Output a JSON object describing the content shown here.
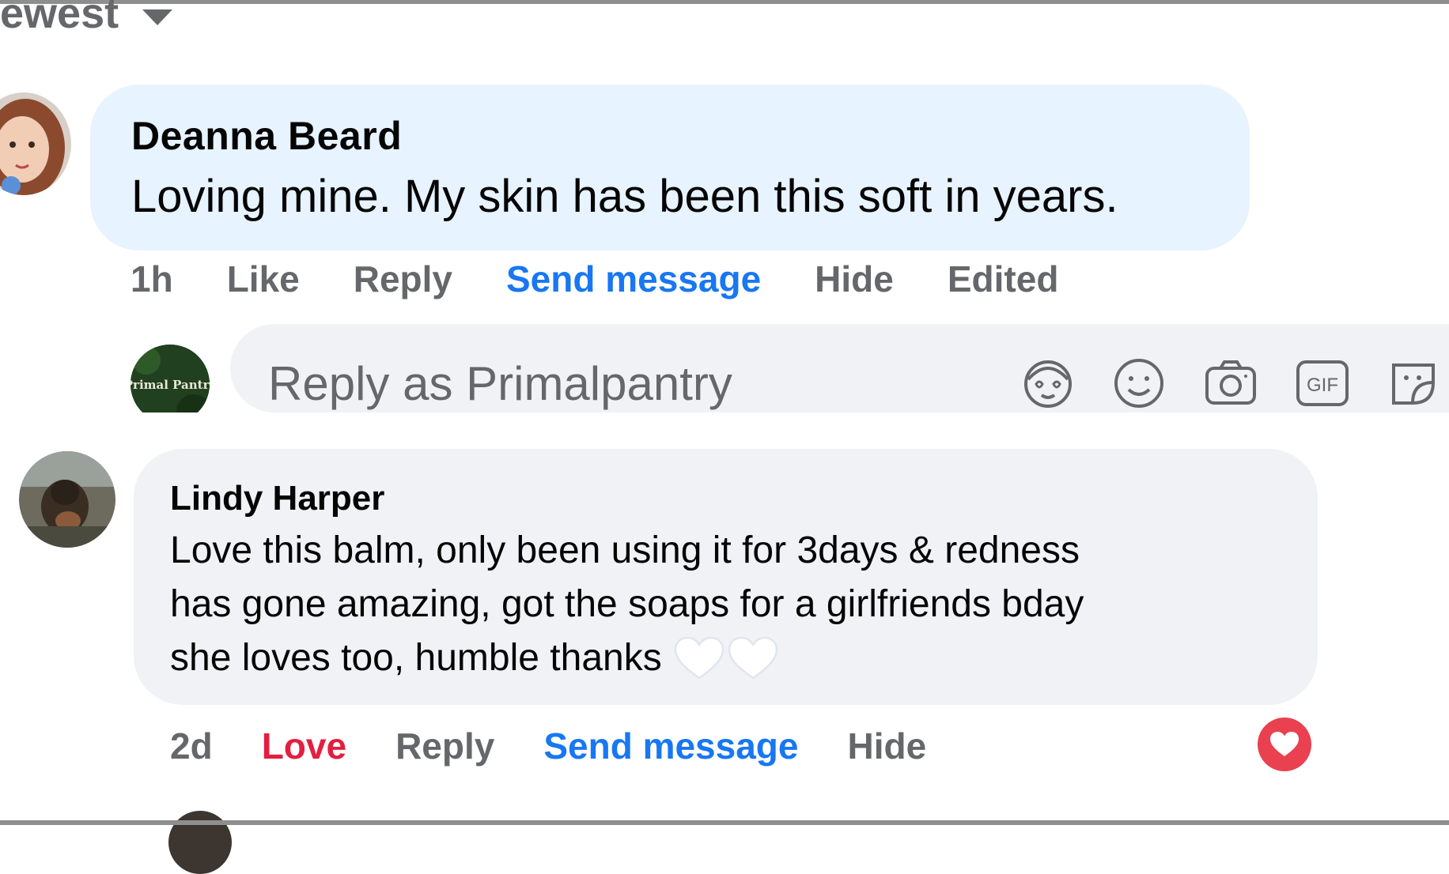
{
  "sort": {
    "label": "ewest",
    "icon": "caret-down-icon"
  },
  "comments": [
    {
      "author": "Deanna Beard",
      "text": "Loving mine. My skin has been this soft in years.",
      "time": "1h",
      "actions": {
        "like": "Like",
        "reply": "Reply",
        "send_message": "Send message",
        "hide": "Hide",
        "edited": "Edited"
      }
    },
    {
      "author": "Lindy Harper",
      "text_lines": [
        "Love this balm, only been using it for 3days & redness",
        "has gone amazing, got the soaps for a girlfriends bday",
        "she loves too, humble thanks"
      ],
      "time": "2d",
      "actions": {
        "love": "Love",
        "reply": "Reply",
        "send_message": "Send message",
        "hide": "Hide"
      },
      "reaction": "love-heart-icon"
    }
  ],
  "reply_box": {
    "avatar_text": "Primal Pantry",
    "placeholder": "Reply as Primalpantry",
    "icons": [
      "avatar-sticker-icon",
      "emoji-icon",
      "camera-icon",
      "gif-icon",
      "sticker-icon"
    ]
  },
  "colors": {
    "link_blue": "#1877f2",
    "love_red": "#e41e3f",
    "bubble_blue": "#e7f3ff",
    "bubble_gray": "#f0f2f5",
    "secondary_text": "#65676b"
  }
}
